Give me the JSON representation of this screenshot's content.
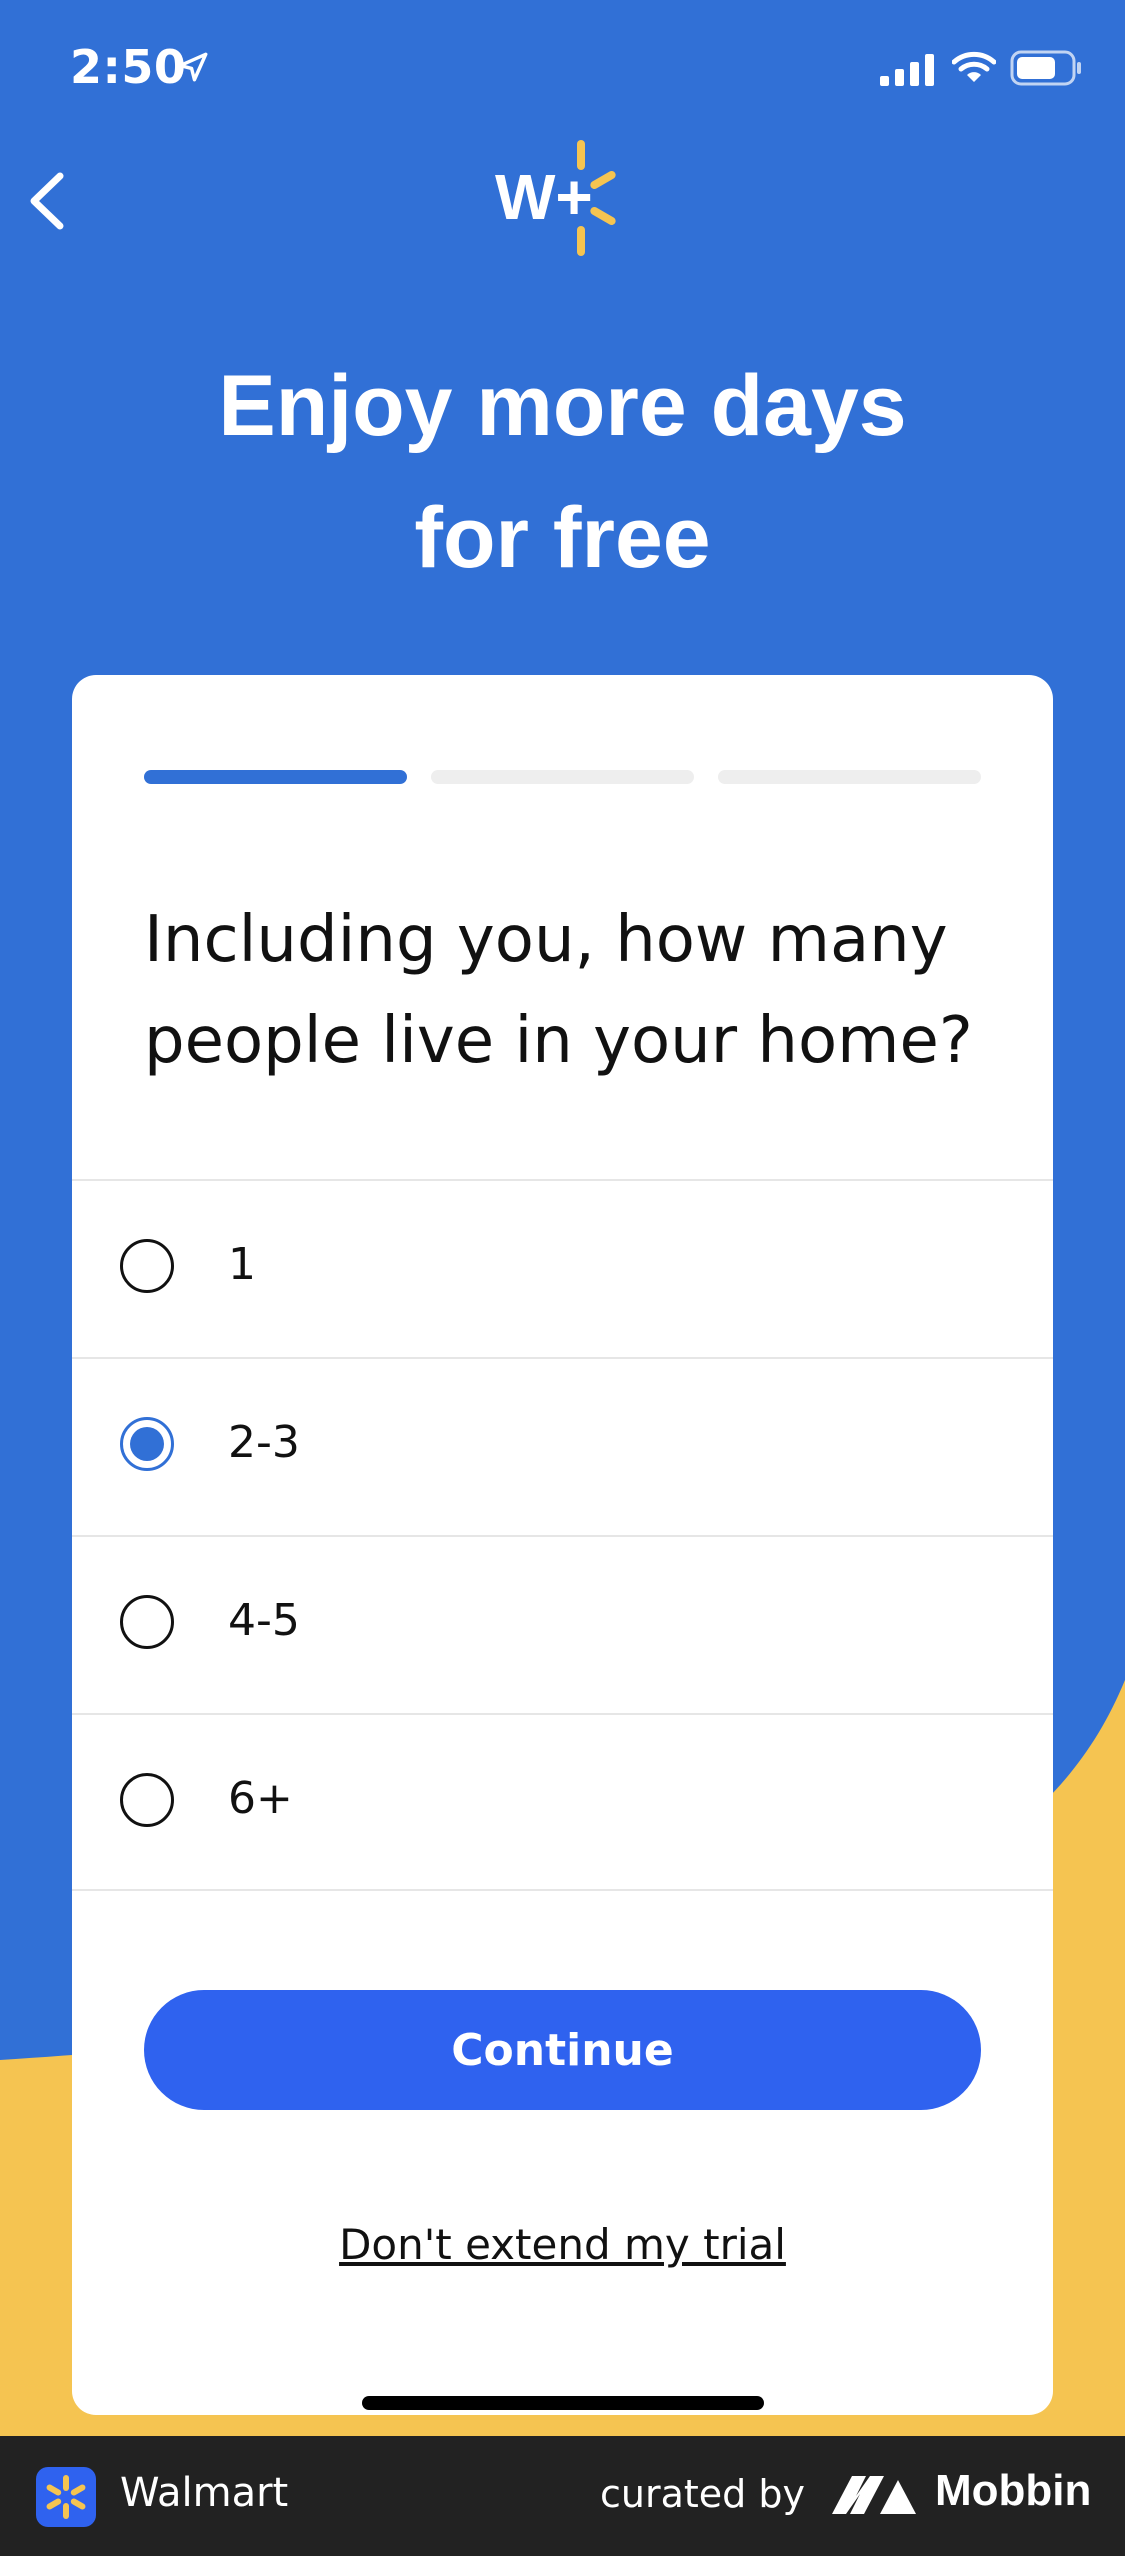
{
  "status_bar": {
    "time": "2:50"
  },
  "header": {
    "logo_text": "W+",
    "headline_line1": "Enjoy more days",
    "headline_line2": "for free"
  },
  "survey": {
    "progress": {
      "current_step": 1,
      "total_steps": 3
    },
    "question": "Including you, how many people live in your home?",
    "options": [
      {
        "label": "1",
        "selected": false
      },
      {
        "label": "2-3",
        "selected": true
      },
      {
        "label": "4-5",
        "selected": false
      },
      {
        "label": "6+",
        "selected": false
      }
    ],
    "continue_label": "Continue",
    "decline_label": "Don't extend my trial"
  },
  "footer": {
    "app_name": "Walmart",
    "curated_label": "curated by",
    "brand": "Mobbin"
  },
  "colors": {
    "background_blue": "#3170d6",
    "accent_yellow": "#f5c451",
    "button_blue": "#2f62ef"
  },
  "icons": [
    "location-arrow-icon",
    "signal-icon",
    "wifi-icon",
    "battery-icon",
    "back-chevron-icon",
    "spark-icon",
    "mobbin-logo-icon"
  ]
}
